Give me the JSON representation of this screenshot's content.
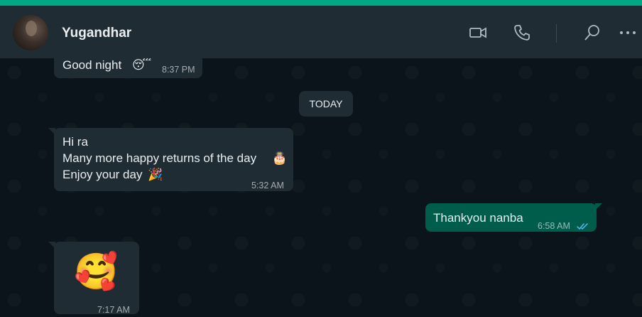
{
  "header": {
    "contact_name": "Yugandhar",
    "icons": [
      "video-call-icon",
      "voice-call-icon",
      "search-icon",
      "menu-icon"
    ]
  },
  "colors": {
    "accent": "#00a884",
    "header_bg": "#202c33",
    "chat_bg": "#0b141a",
    "incoming_bubble": "#202c33",
    "outgoing_bubble": "#005c4b",
    "read_ticks": "#53bdeb"
  },
  "messages": [
    {
      "direction": "incoming",
      "text": "Good night",
      "emoji": "😴",
      "time": "8:37 PM"
    },
    {
      "separator": "TODAY"
    },
    {
      "direction": "incoming",
      "lines": [
        "Hi ra",
        "Many more happy returns of the day",
        "Enjoy your day"
      ],
      "emojis": [
        "🎂",
        "🎉"
      ],
      "time": "5:32 AM"
    },
    {
      "direction": "outgoing",
      "text": "Thankyou nanba",
      "time": "6:58 AM",
      "status": "read"
    },
    {
      "direction": "incoming",
      "emoji": "🥰",
      "time": "7:17 AM"
    }
  ]
}
